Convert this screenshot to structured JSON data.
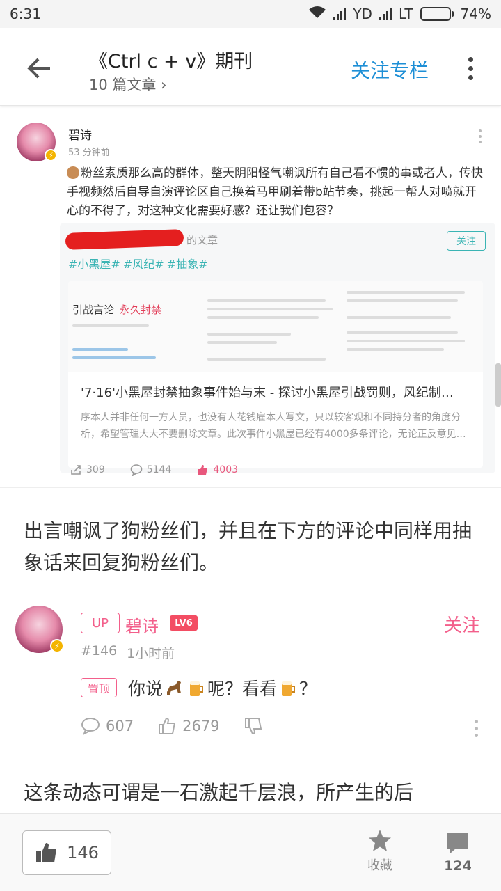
{
  "status_bar": {
    "time": "6:31",
    "carrier1": "YD",
    "carrier2": "LT",
    "battery": "74%",
    "battery_level": 0.74
  },
  "header": {
    "title": "《Ctrl c + v》期刊",
    "subtitle": "10 篇文章",
    "follow_label": "关注专栏"
  },
  "post": {
    "author": "碧诗",
    "time": "53 分钟前",
    "text": "粉丝素质那么高的群体，整天阴阳怪气嘲讽所有自己看不惯的事或者人，传快手视频然后自导自演评论区自己换着马甲刷着带b站节奏，挑起一帮人对喷就开心的不得了，对这种文化需要好感？还让我们包容？",
    "card": {
      "author_suffix": "的文章",
      "follow": "关注",
      "tags": [
        "#小黑屋#",
        "#风纪#",
        "#抽象#"
      ],
      "thumb_title": "引战言论",
      "thumb_badge": "永久封禁",
      "title": "'7·16'小黑屋封禁抽象事件始与末 - 探讨小黑屋引战罚则，风纪制…",
      "desc": "序本人并非任何一方人员，也没有人花钱雇本人写文，只以较客观和不同持分者的角度分析，希望管理大大不要删除文章。此次事件小黑屋已经有4000多条评论，无论正反意见…"
    },
    "stats": {
      "share": "309",
      "comment": "5144",
      "like": "4003"
    }
  },
  "article": {
    "para1": "出言嘲讽了狗粉丝们，并且在下方的评论中同样用抽象话来回复狗粉丝们。",
    "para2": "这条动态可谓是一石激起千层浪，所产生的后"
  },
  "comment": {
    "up_tag": "UP",
    "name": "碧诗",
    "level": "LV6",
    "follow": "关注",
    "floor": "#146",
    "time": "1小时前",
    "pin_tag": "置顶",
    "text_a": "你说",
    "text_b": "呢？看看",
    "text_c": "？",
    "replies": "607",
    "likes": "2679"
  },
  "bottom_bar": {
    "likes": "146",
    "favorite": "收藏",
    "comments": "124"
  },
  "colors": {
    "accent_blue": "#1e8fd6",
    "pink": "#f35f8b",
    "teal": "#3ab4b4"
  }
}
